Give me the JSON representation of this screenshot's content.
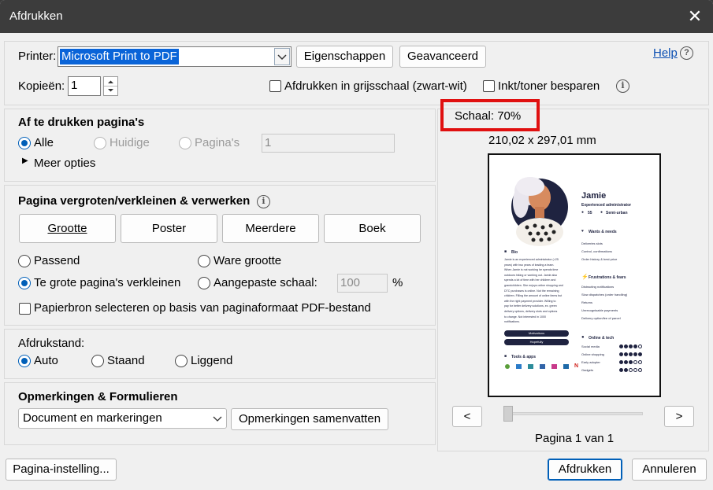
{
  "window": {
    "title": "Afdrukken",
    "close_glyph": "✕"
  },
  "top": {
    "printer_label": "Printer:",
    "printer_value": "Microsoft Print to PDF",
    "properties_button": "Eigenschappen",
    "advanced_button": "Geavanceerd",
    "help_link": "Help",
    "copies_label": "Kopieën:",
    "copies_value": "1",
    "grayscale_label": "Afdrukken in grijsschaal (zwart-wit)",
    "save_ink_label": "Inkt/toner besparen"
  },
  "pages": {
    "heading": "Af te drukken pagina's",
    "all": "Alle",
    "current": "Huidige",
    "pages": "Pagina's",
    "pages_value": "1",
    "more": "Meer opties"
  },
  "sizing": {
    "heading": "Pagina vergroten/verkleinen & verwerken",
    "buttons": [
      "Grootte",
      "Poster",
      "Meerdere",
      "Boek"
    ],
    "fit": "Passend",
    "actual": "Ware grootte",
    "shrink": "Te grote pagina's verkleinen",
    "custom": "Aangepaste schaal:",
    "custom_value": "100",
    "percent": "%",
    "paper_source": "Papierbron selecteren op basis van paginaformaat PDF-bestand"
  },
  "orientation": {
    "heading": "Afdrukstand:",
    "auto": "Auto",
    "portrait": "Staand",
    "landscape": "Liggend"
  },
  "comments": {
    "heading": "Opmerkingen & Formulieren",
    "select_value": "Document en markeringen",
    "summarize_button": "Opmerkingen samenvatten"
  },
  "preview": {
    "scale": "Schaal:  70%",
    "dimensions": "210,02 x 297,01 mm",
    "prev": "<",
    "next": ">",
    "page_info": "Pagina 1 van 1",
    "highlight_color": "#e01010",
    "doc": {
      "name": "Jamie",
      "role": "Experienced administrator",
      "age": "55",
      "location": "Semi-urban",
      "bio_title": "Bio",
      "bio_lines": [
        "Jamie is an experienced administrator (>25",
        "years) with two years of leading a team.",
        "When Jamie is not working he spends time",
        "outdoors hiking or working out. Jamie also",
        "spends a lot of time with her children and",
        "grandchildren. She enjoys online shopping and",
        "DTC purchases is online. Not the remaining",
        "children. Filling the amount of online items but",
        "with the right payment provider. Willing to",
        "pay for better delivery solutions, ex. green",
        "delivery options, delivery slots and options",
        "to change. Not interested in 1000",
        "notifications."
      ],
      "pill1": "Motivations",
      "pill2": "Hopefully",
      "tools_title": "Tools & apps",
      "wants_title": "Wants & needs",
      "wants": [
        "Deliveries slots",
        "Control, confirmations",
        "Order history & best price"
      ],
      "frustrations_title": "Frustrations & fears",
      "frustrations": [
        "Distracting notifications",
        "Slow dispatches (order handling)",
        "Returns",
        "Unrecognisable payments",
        "Delivery option/fee of parcel"
      ],
      "online_title": "Online & tech",
      "online": [
        {
          "label": "Social media",
          "level": 4
        },
        {
          "label": "Online shopping",
          "level": 5
        },
        {
          "label": "Early adopter",
          "level": 3
        },
        {
          "label": "Gadgets",
          "level": 2
        }
      ]
    }
  },
  "footer": {
    "page_setup": "Pagina-instelling...",
    "print": "Afdrukken",
    "cancel": "Annuleren"
  },
  "colors": {
    "accent": "#005fb8",
    "link": "#0b4fb3"
  }
}
